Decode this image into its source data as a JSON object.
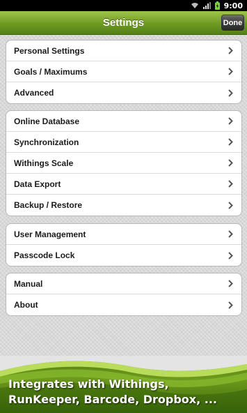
{
  "status_bar": {
    "time": "9:00",
    "icons": [
      "wifi-icon",
      "signal-icon",
      "battery-charging-icon"
    ]
  },
  "header": {
    "title": "Settings",
    "done_label": "Done",
    "accent_color": "#6e9a22"
  },
  "groups": [
    {
      "items": [
        "Personal Settings",
        "Goals / Maximums",
        "Advanced"
      ]
    },
    {
      "items": [
        "Online Database",
        "Synchronization",
        "Withings Scale",
        "Data Export",
        "Backup / Restore"
      ]
    },
    {
      "items": [
        "User Management",
        "Passcode Lock"
      ]
    },
    {
      "items": [
        "Manual",
        "About"
      ]
    }
  ],
  "row_icon": "chevron-right-icon",
  "promo_banner": {
    "line1": "Integrates with Withings,",
    "line2": "RunKeeper, Barcode, Dropbox, ..."
  }
}
